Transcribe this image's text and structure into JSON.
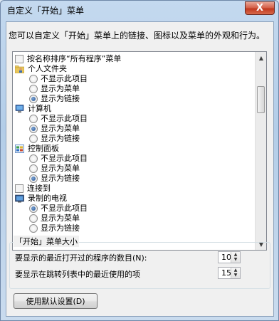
{
  "window": {
    "title": "自定义「开始」菜单",
    "close_glyph": "X"
  },
  "description": "您可以自定义「开始」菜单上的链接、图标以及菜单的外观和行为。",
  "list": [
    {
      "kind": "check",
      "label": "按名称排序“所有程序”菜单",
      "checked": false
    },
    {
      "kind": "header",
      "icon": "user-folder-icon",
      "label": "个人文件夹"
    },
    {
      "kind": "radio",
      "label": "不显示此项目",
      "selected": false
    },
    {
      "kind": "radio",
      "label": "显示为菜单",
      "selected": false
    },
    {
      "kind": "radio",
      "label": "显示为链接",
      "selected": true
    },
    {
      "kind": "header",
      "icon": "computer-icon",
      "label": "计算机"
    },
    {
      "kind": "radio",
      "label": "不显示此项目",
      "selected": false
    },
    {
      "kind": "radio",
      "label": "显示为菜单",
      "selected": true
    },
    {
      "kind": "radio",
      "label": "显示为链接",
      "selected": false
    },
    {
      "kind": "header",
      "icon": "control-panel-icon",
      "label": "控制面板"
    },
    {
      "kind": "radio",
      "label": "不显示此项目",
      "selected": false
    },
    {
      "kind": "radio",
      "label": "显示为菜单",
      "selected": false
    },
    {
      "kind": "radio",
      "label": "显示为链接",
      "selected": true
    },
    {
      "kind": "check",
      "label": "连接到",
      "checked": false
    },
    {
      "kind": "header",
      "icon": "recorded-tv-icon",
      "label": "录制的电视"
    },
    {
      "kind": "radio",
      "label": "不显示此项目",
      "selected": true
    },
    {
      "kind": "radio",
      "label": "显示为菜单",
      "selected": false
    },
    {
      "kind": "radio",
      "label": "显示为链接",
      "selected": false
    }
  ],
  "size_group": {
    "title": "「开始」菜单大小",
    "recent_programs_label": "要显示的最近打开过的程序的数目(N):",
    "recent_programs_value": "10",
    "jump_list_label": "要显示在跳转列表中的最近使用的项",
    "jump_list_value": "15"
  },
  "buttons": {
    "defaults": "使用默认设置(D)"
  }
}
